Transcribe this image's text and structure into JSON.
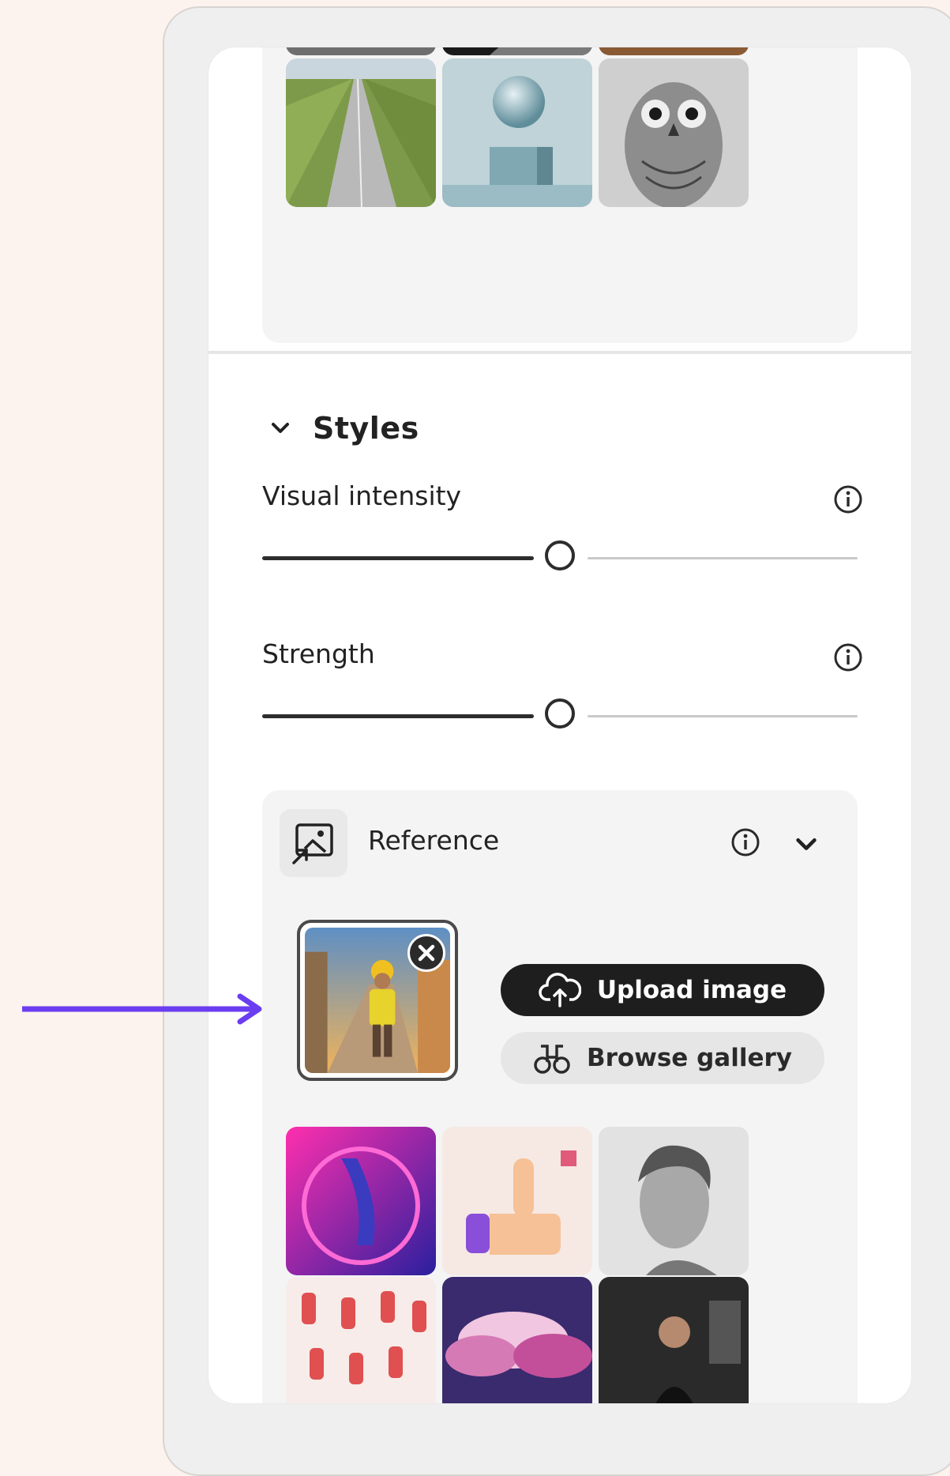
{
  "styles": {
    "section_title": "Styles",
    "visual_intensity": {
      "label": "Visual intensity",
      "value_percent": 50
    },
    "strength": {
      "label": "Strength",
      "value_percent": 50
    }
  },
  "reference": {
    "label": "Reference",
    "upload_button": "Upload image",
    "browse_button": "Browse gallery"
  },
  "colors": {
    "background": "#fdf3ee",
    "accent_arrow": "#6b3df0",
    "primary_button": "#1e1e1e"
  },
  "icons": [
    "chevron-down-icon",
    "info-icon",
    "reference-image-icon",
    "close-icon",
    "upload-cloud-icon",
    "binoculars-icon",
    "arrow-right-icon"
  ]
}
